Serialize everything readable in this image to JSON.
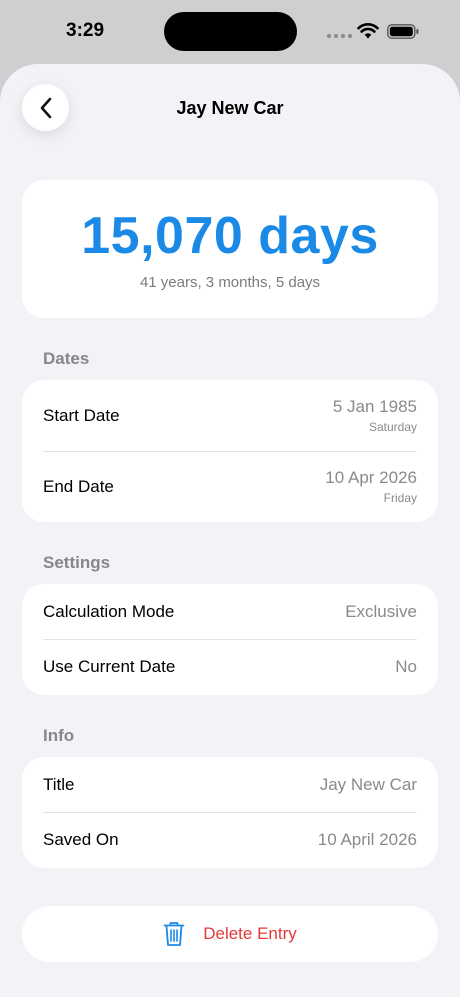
{
  "status_bar": {
    "time": "3:29"
  },
  "header": {
    "title": "Jay New Car"
  },
  "summary": {
    "total": "15,070 days",
    "breakdown": "41 years, 3 months, 5 days"
  },
  "dates": {
    "header": "Dates",
    "start": {
      "label": "Start Date",
      "value": "5 Jan 1985",
      "weekday": "Saturday"
    },
    "end": {
      "label": "End Date",
      "value": "10 Apr 2026",
      "weekday": "Friday"
    }
  },
  "settings": {
    "header": "Settings",
    "calc_mode": {
      "label": "Calculation Mode",
      "value": "Exclusive"
    },
    "use_current": {
      "label": "Use Current Date",
      "value": "No"
    }
  },
  "info": {
    "header": "Info",
    "title": {
      "label": "Title",
      "value": "Jay New Car"
    },
    "saved_on": {
      "label": "Saved On",
      "value": "10 April 2026"
    }
  },
  "actions": {
    "delete_label": "Delete Entry"
  },
  "colors": {
    "accent": "#1a8ae6",
    "destructive": "#e5383b"
  },
  "icons": {
    "back": "chevron-left-icon",
    "delete": "trash-icon"
  }
}
